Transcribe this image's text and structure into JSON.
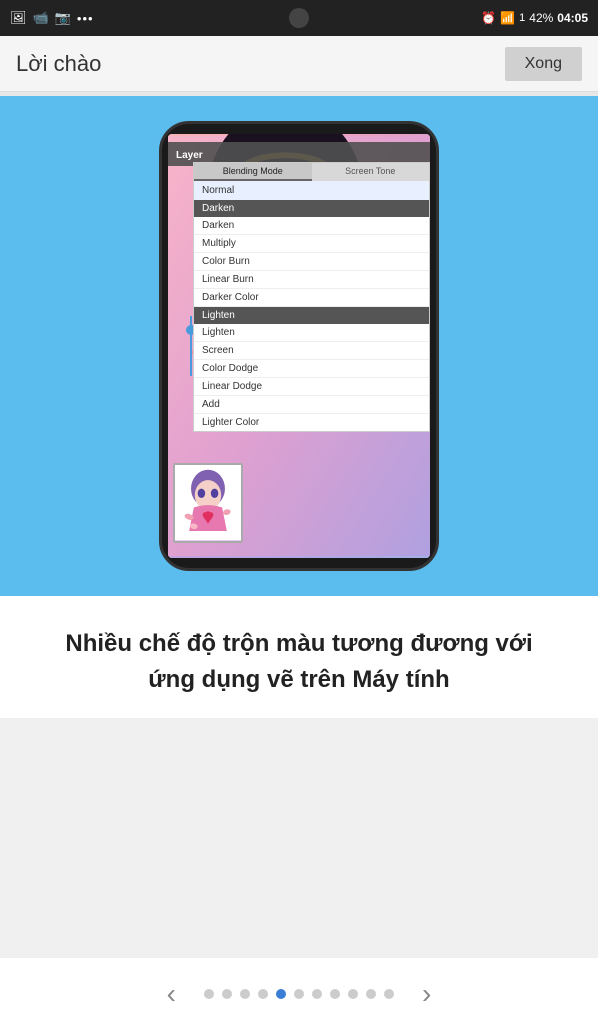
{
  "statusBar": {
    "icons_left": [
      "image-icon",
      "video-icon",
      "camera-icon",
      "more-icon"
    ],
    "time": "04:05",
    "battery": "42%",
    "signal": "1"
  },
  "titleBar": {
    "title": "Lời chào",
    "close_button": "Xong"
  },
  "blendPanel": {
    "tab1": "Blending Mode",
    "tab2": "Screen Tone",
    "items": [
      {
        "label": "Normal",
        "style": "selected-light"
      },
      {
        "label": "Darken",
        "style": "section-header"
      },
      {
        "label": "Darken",
        "style": "normal"
      },
      {
        "label": "Multiply",
        "style": "normal"
      },
      {
        "label": "Color Burn",
        "style": "normal"
      },
      {
        "label": "Linear Burn",
        "style": "normal"
      },
      {
        "label": "Darker Color",
        "style": "normal"
      },
      {
        "label": "Lighten",
        "style": "section-header"
      },
      {
        "label": "Lighten",
        "style": "normal"
      },
      {
        "label": "Screen",
        "style": "normal"
      },
      {
        "label": "Color Dodge",
        "style": "normal"
      },
      {
        "label": "Linear Dodge",
        "style": "normal"
      },
      {
        "label": "Add",
        "style": "normal"
      },
      {
        "label": "Lighter Color",
        "style": "normal"
      }
    ]
  },
  "layerPanel": {
    "label": "Layer"
  },
  "mainText": "Nhiều chế độ trộn màu tương đương với ứng dụng vẽ trên Máy tính",
  "navigation": {
    "dots": 11,
    "active_dot": 4,
    "left_arrow": "‹",
    "right_arrow": "›"
  }
}
